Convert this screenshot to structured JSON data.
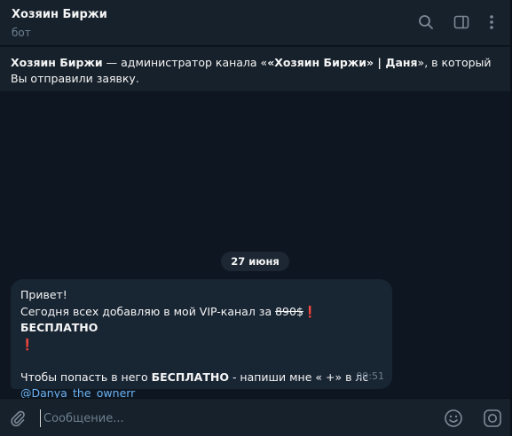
{
  "header": {
    "title": "Хозяин Биржи",
    "subtitle": "бот",
    "icons": [
      "search-icon",
      "sidebar-toggle-icon",
      "more-vertical-icon"
    ]
  },
  "notice": {
    "name": "Хозяин Биржи",
    "text_1": " — администратор канала «",
    "channel": "«Хозяин Биржи» | Даня",
    "text_2": "», в который",
    "text_3": "Вы отправили заявку."
  },
  "date_separator": "27 июня",
  "message": {
    "line1": "Привет!",
    "line2_prefix": "Сегодня всех добавляю в мой VIP-канал за ",
    "old_price": "890$",
    "excl1": "❗",
    "free1": "БЕСПЛАТНО",
    "excl2": "❗",
    "line3_prefix": "Чтобы попасть в него ",
    "free2": "БЕСПЛАТНО",
    "line3_suffix": " - напиши мне « +» в лс",
    "mention": "@Danya_the_ownerr",
    "time": "09:51"
  },
  "composer": {
    "placeholder": "Сообщение...",
    "value": "",
    "icons": [
      "attach-icon",
      "emoji-icon",
      "instagram-icon"
    ]
  },
  "colors": {
    "background": "#0e1621",
    "panel": "#17212b",
    "bubble": "#182533",
    "link": "#6ab2f2",
    "muted": "#6d7f8f"
  }
}
